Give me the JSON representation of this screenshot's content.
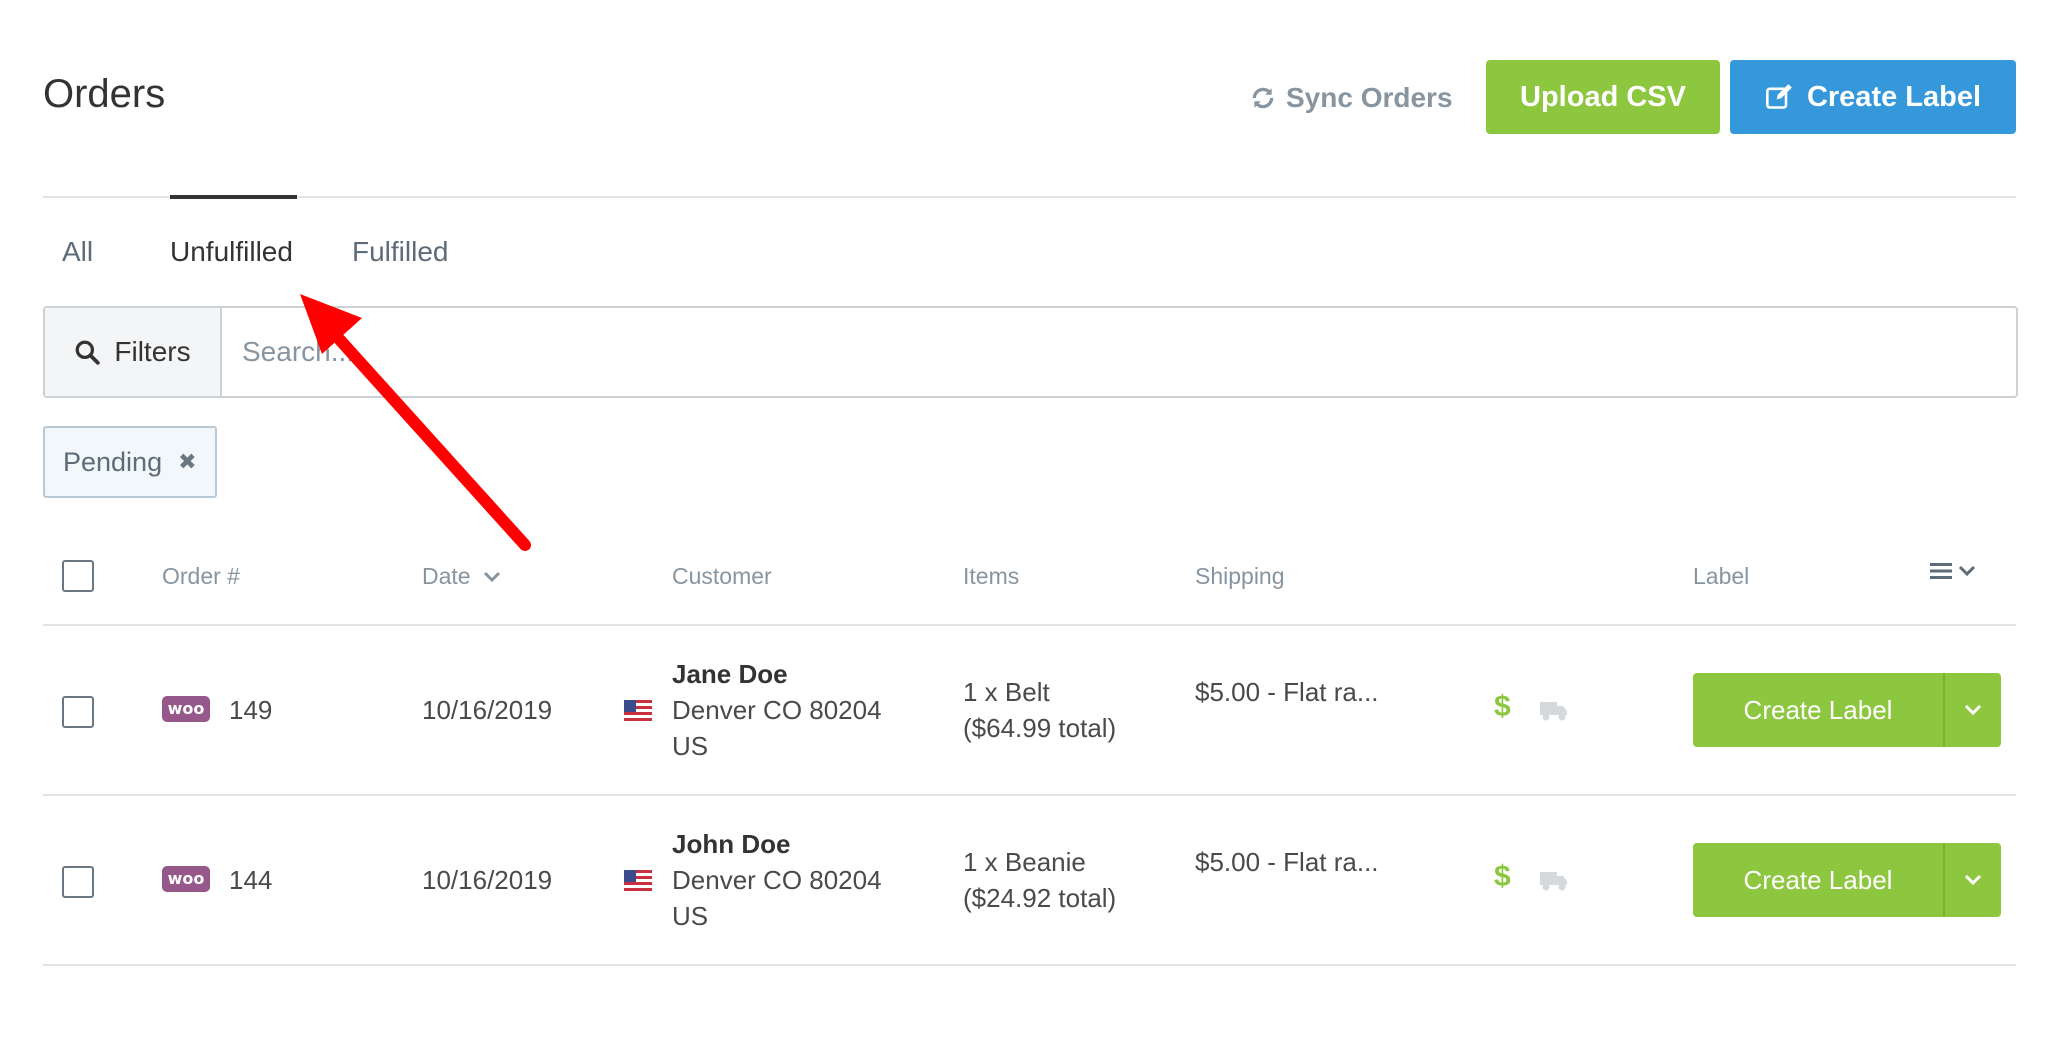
{
  "header": {
    "title": "Orders",
    "sync_label": "Sync Orders",
    "upload_label": "Upload CSV",
    "create_label": "Create Label"
  },
  "tabs": [
    {
      "label": "All",
      "active": false
    },
    {
      "label": "Unfulfilled",
      "active": true
    },
    {
      "label": "Fulfilled",
      "active": false
    }
  ],
  "search": {
    "filters_label": "Filters",
    "placeholder": "Search..."
  },
  "active_filter": {
    "label": "Pending"
  },
  "table": {
    "columns": [
      "Order #",
      "Date",
      "Customer",
      "Items",
      "Shipping",
      "Label"
    ],
    "rows": [
      {
        "order_no": "149",
        "date": "10/16/2019",
        "customer_name": "Jane Doe",
        "customer_city": "Denver CO 80204",
        "customer_country": "US",
        "items_line1": "1 x Belt",
        "items_line2": "($64.99 total)",
        "shipping": "$5.00 - Flat ra...",
        "label_button": "Create Label"
      },
      {
        "order_no": "144",
        "date": "10/16/2019",
        "customer_name": "John Doe",
        "customer_city": "Denver CO 80204",
        "customer_country": "US",
        "items_line1": "1 x Beanie",
        "items_line2": "($24.92 total)",
        "shipping": "$5.00 - Flat ra...",
        "label_button": "Create Label"
      }
    ]
  },
  "icons": {
    "store_badge": "woo",
    "dollar": "$"
  },
  "colors": {
    "green": "#8dc63f",
    "blue": "#3498db",
    "annotation_arrow": "#ff0000",
    "woo_purple": "#96588a"
  }
}
